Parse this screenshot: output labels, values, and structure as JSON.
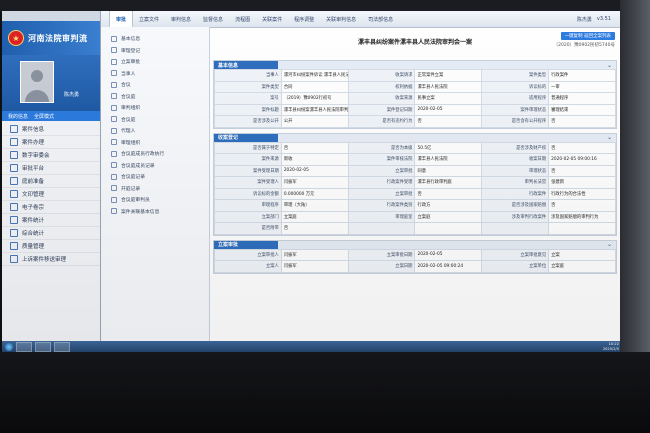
{
  "browser_tabs": [
    "",
    ""
  ],
  "bg_app": {
    "court_name": "河南法院审判流",
    "username": "陈杰勇",
    "links": [
      "我的信息",
      "全屏模式"
    ],
    "menu": [
      "案件信息",
      "案件办理",
      "数字审委会",
      "审批平台",
      "庭前准备",
      "文印管理",
      "电子卷宗",
      "案件统计",
      "综合统计",
      "质量管理",
      "上诉案件移送审理"
    ]
  },
  "topnav": {
    "items": [
      "审批",
      "立案文件",
      "审判信息",
      "监督信息",
      "流程图",
      "关联案件",
      "程序调整",
      "关联审判信息",
      "司法部信息"
    ],
    "user": "陈杰勇",
    "version": "v3.51"
  },
  "sidebar": {
    "items": [
      "基本信息",
      "审理登记",
      "立案审批",
      "当事人",
      "合议",
      "合议庭",
      "审判组织",
      "合议庭",
      "代理人",
      "审理组织",
      "合议庭成员行政执行",
      "合议庭成员记录",
      "合议庭记录",
      "开庭记录",
      "合议庭审判员",
      "案件关联基本信息"
    ]
  },
  "doc": {
    "title": "漯丰县纠纷案件漯丰县人民法院审判会一案",
    "back_button": "一键复制 返回全案列表",
    "case_no": "（2020）豫0902民初5740号"
  },
  "sections": {
    "basic": {
      "title": "基本信息",
      "rows": [
        [
          "当事人",
          "漯河市纠纷案件诉讼 漯丰县人民法院诉讼中心",
          "收案请求",
          "正常案件立案",
          "案件类型",
          "行政案件"
        ],
        [
          "案件类型",
          "合同",
          "权利依据",
          "漯丰县人民法院",
          "诉讼标的",
          "一审"
        ],
        [
          "案号",
          "（2019）豫0902行初号",
          "收案来源",
          "民事立案",
          "适用程序",
          "普通程序"
        ],
        [
          "案件标题",
          "漯丰县纠纷案漯丰县人民法院审判会一案",
          "案件登记日期",
          "2020-02-05",
          "案件审理状态",
          "審理结束"
        ],
        [
          "是否涉及公开",
          "公开",
          "是否有违约行为",
          "否",
          "是否含有公开程序",
          "否"
        ]
      ]
    },
    "register": {
      "title": "收案登记",
      "rows": [
        [
          "是否属于特定",
          "否",
          "是否为本级",
          "50.5亿",
          "是否涉及财产权",
          "否"
        ],
        [
          "案件来源",
          "新收",
          "案件审核法院",
          "漯丰县人民法院",
          "收案日期",
          "2020-02-05 09:00:16"
        ],
        [
          "案件受理日期",
          "2020-02-05",
          "立案审批",
          "同意",
          "审理状态",
          "否"
        ],
        [
          "案件受理人",
          "闫振军",
          "行政案件受理",
          "漯丰县行政审判庭",
          "审判长法官",
          "张建新"
        ],
        [
          "诉讼标的金额",
          "0.000000 万元",
          "立案审批",
          "否",
          "行政案件",
          "行政行为的合法性"
        ],
        [
          "审理程序",
          "审理（大陆）",
          "行政案件类别",
          "行政方",
          "是否涉及国家赔偿",
          "否"
        ],
        [
          "立案部门",
          "立案庭",
          "审理庭室",
          "立案庭",
          "涉及审判行政案件",
          "涉及国家赔偿的审判行为"
        ],
        [
          "是否附带",
          "否",
          "",
          "",
          "",
          ""
        ]
      ]
    },
    "approval": {
      "title": "立案审批",
      "rows": [
        [
          "立案审批人",
          "闫振军",
          "立案审批日期",
          "2020-02-05",
          "立案审批意见",
          "立案"
        ],
        [
          "立案人",
          "闫振军",
          "立案日期",
          "2020-02-05 09:00:24",
          "立案单位",
          "立案庭"
        ]
      ]
    }
  },
  "taskbar": {
    "time": "10:22",
    "date": "2020/2/5"
  }
}
